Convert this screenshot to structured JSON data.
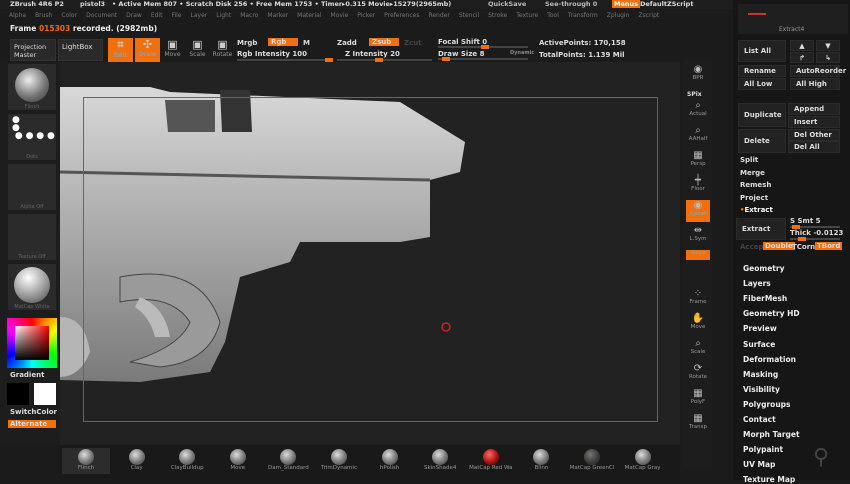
{
  "title": {
    "app": "ZBrush 4R6 P2",
    "doc": "pistol3",
    "stats": "• Active Mem 807 • Scratch Disk 256 • Free Mem 1753 • Timer▸0.315 Movie▸15279(2965mb)",
    "quicksave": "QuickSave",
    "seethrough": "See-through 0",
    "menus": "Menus",
    "script": "DefaultZScript"
  },
  "menu": [
    "Alpha",
    "Brush",
    "Color",
    "Document",
    "Draw",
    "Edit",
    "File",
    "Layer",
    "Light",
    "Macro",
    "Marker",
    "Material",
    "Movie",
    "Picker",
    "Preferences",
    "Render",
    "Stencil",
    "Stroke",
    "Texture",
    "Tool",
    "Transform",
    "Zplugin",
    "Zscript"
  ],
  "status": {
    "prefix": "Frame",
    "frame": "015303",
    "suffix": "recorded. (2982mb)"
  },
  "toolbar": {
    "projection": "Projection Master",
    "lightbox": "LightBox",
    "edit": "Edit",
    "draw": "Draw",
    "move": "Move",
    "scale": "Scale",
    "rotate": "Rotate",
    "mrgb": "Mrgb",
    "rgb": "Rgb",
    "m": "M",
    "rgb_intensity": "Rgb Intensity 100",
    "zadd": "Zadd",
    "zsub": "Zsub",
    "zcut": "Zcut",
    "z_intensity": "Z Intensity 20",
    "focal_shift": "Focal Shift 0",
    "draw_size": "Draw Size 8",
    "dynamic": "Dynamic",
    "active_points": "ActivePoints: 170,158",
    "total_points": "TotalPoints: 1.139 Mil"
  },
  "left": {
    "brush": "Flinch",
    "stroke": "Dots",
    "alpha": "Alpha Off",
    "texture": "Texture Off",
    "material": "MatCap White",
    "gradient": "Gradient",
    "switchcolor": "SwitchColor",
    "alternate": "Alternate"
  },
  "rshelf": [
    "BPR",
    "SPix",
    "Actual",
    "AAHalf",
    "Persp",
    "Floor",
    "Local",
    "L.Sym",
    "Gxyz",
    "Frame",
    "Move",
    "Scale",
    "Rotate",
    "PolyF",
    "Transp"
  ],
  "subtool": {
    "name": "Extract4",
    "list_all": "List All",
    "rename": "Rename",
    "autoreorder": "AutoReorder",
    "all_low": "All Low",
    "all_high": "All High",
    "duplicate": "Duplicate",
    "append": "Append",
    "insert": "Insert",
    "delete": "Delete",
    "del_other": "Del Other",
    "del_all": "Del All",
    "split": "Split",
    "merge": "Merge",
    "remesh": "Remesh",
    "project": "Project",
    "extract_section": "Extract",
    "extract_btn": "Extract",
    "s_smt": "S Smt 5",
    "thick": "Thick -0.0123",
    "accept": "Accept",
    "double": "Double",
    "tcorn": "TCorn",
    "tbord": "TBord"
  },
  "tool_menus": [
    "Geometry",
    "Layers",
    "FiberMesh",
    "Geometry HD",
    "Preview",
    "Surface",
    "Deformation",
    "Masking",
    "Visibility",
    "Polygroups",
    "Contact",
    "Morph Target",
    "Polypaint",
    "UV Map",
    "Texture Map"
  ],
  "brushes": [
    "Flinch",
    "Clay",
    "ClayBuildup",
    "Move",
    "Dam_Standard",
    "TrimDynamic",
    "hPolish",
    "SkinShade4",
    "MatCap Red Wa",
    "Blinn",
    "MatCap GreenCl",
    "MatCap Gray"
  ],
  "colors": {
    "accent": "#f07010"
  }
}
